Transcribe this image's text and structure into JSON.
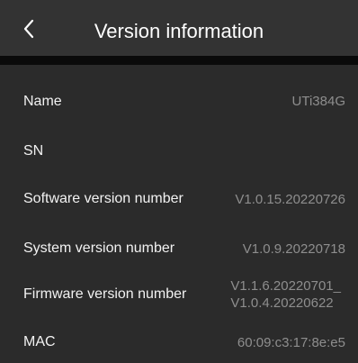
{
  "header": {
    "title": "Version information"
  },
  "icons": {
    "back": "chevron-left-icon"
  },
  "colors": {
    "background": "#2b2b2b",
    "header": "#333333",
    "label": "#f2f2f2",
    "value": "#8e8e8e"
  },
  "info": {
    "name": {
      "label": "Name",
      "value": "UTi384G"
    },
    "sn": {
      "label": "SN",
      "value": ""
    },
    "software": {
      "label": "Software version number",
      "value": "V1.0.15.20220726"
    },
    "system": {
      "label": "System version number",
      "value": "V1.0.9.20220718"
    },
    "firmware": {
      "label": "Firmware version number",
      "value_line1": "V1.1.6.20220701_",
      "value_line2": "V1.0.4.20220622"
    },
    "mac": {
      "label": "MAC",
      "value": "60:09:c3:17:8e:e5"
    }
  }
}
